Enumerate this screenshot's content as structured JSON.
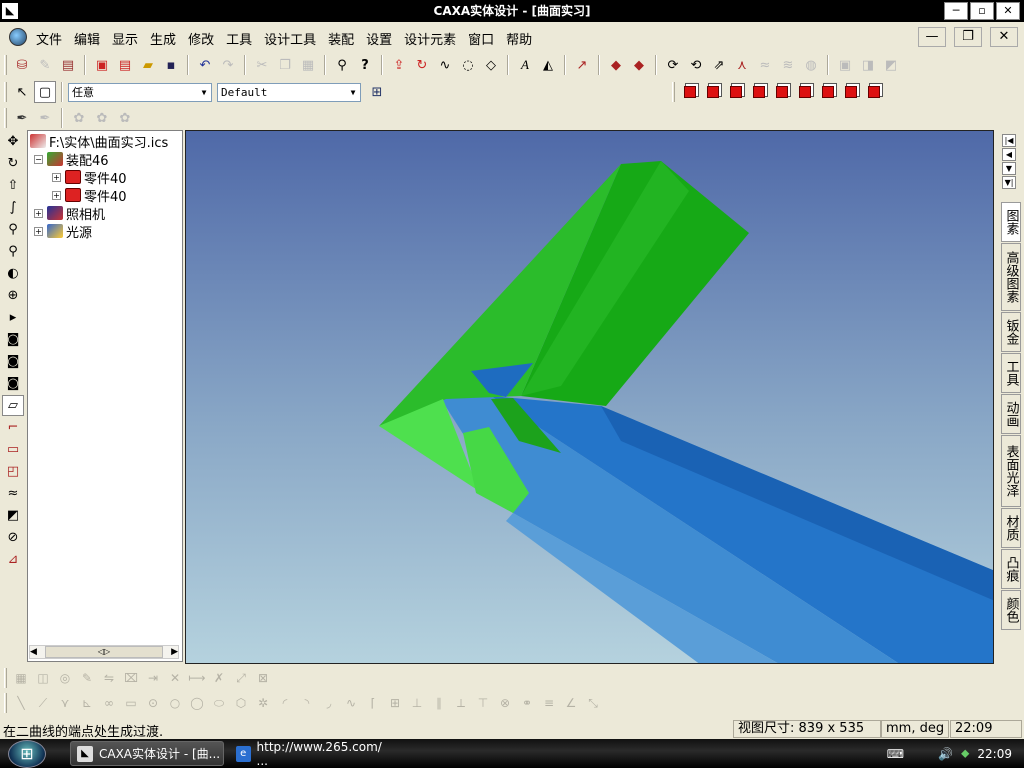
{
  "window": {
    "title": "CAXA实体设计 - [曲面实习]",
    "app_icon": "caxa-app-icon",
    "caption_minimize": "─",
    "caption_maximize": "▫",
    "caption_close": "✕"
  },
  "menu": {
    "items": [
      "文件",
      "编辑",
      "显示",
      "生成",
      "修改",
      "工具",
      "设计工具",
      "装配",
      "设置",
      "设计元素",
      "窗口",
      "帮助"
    ],
    "doc_minimize": "—",
    "doc_restore": "❐",
    "doc_close": "✕"
  },
  "toolbar": {
    "combo_select_value": "任意",
    "combo_config_value": "Default"
  },
  "tree": {
    "root": "F:\\实体\\曲面实习.ics",
    "assembly": "装配46",
    "parts": [
      "零件40",
      "零件40"
    ],
    "camera": "照相机",
    "light": "光源"
  },
  "design_elements_tabs": [
    "图素",
    "高级图素",
    "钣金",
    "工具",
    "动画",
    "表面光泽",
    "材质",
    "凸痕",
    "颜色"
  ],
  "status": {
    "message": "在二曲线的端点处生成过渡.",
    "view_size_label": "视图尺寸:",
    "view_size_value": "839 x 535",
    "units": "mm, deg",
    "time": "22:09"
  },
  "taskbar": {
    "tasks": [
      "CAXA实体设计 - [曲...",
      "http://www.265.com/ ..."
    ],
    "clock": "22:09"
  },
  "colors": {
    "green_part": "#22b422",
    "blue_part": "#1e72c6",
    "viewport_top": "#4f69a8",
    "viewport_bottom": "#b5d2de"
  }
}
